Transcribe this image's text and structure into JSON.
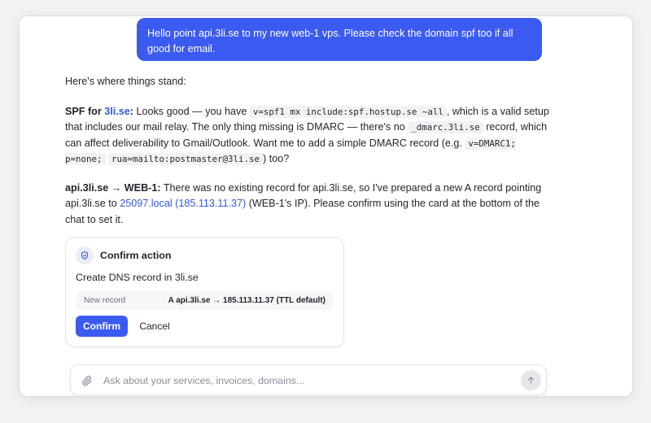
{
  "chat": {
    "user_message": "Hello point api.3li.se to my new web-1 vps. Please check the domain spf too if all good for email."
  },
  "assistant": {
    "intro": "Here's where things stand:",
    "spf": {
      "label_prefix": "SPF for ",
      "domain_link": "3li.se",
      "label_suffix": ":",
      "t1": " Looks good — you have ",
      "code1": "v=spf1 mx include:spf.hostup.se ~all",
      "t2": ", which is a valid setup that includes our mail relay. The only thing missing is DMARC — there's no ",
      "code2": "_dmarc.3li.se",
      "t3": " record, which can affect deliverability to Gmail/Outlook. Want me to add a simple DMARC record (e.g. ",
      "code3a": "v=DMARC1; p=none;",
      "code3b": "rua=mailto:postmaster@3li.se",
      "t4": ") too?"
    },
    "api": {
      "label": "api.3li.se → WEB-1:",
      "t1": " There was no existing record for api.3li.se, so I've prepared a new A record pointing api.3li.se to ",
      "link": "25097.local (185.113.11.37)",
      "t2": " (WEB-1's IP). Please confirm using the card at the bottom of the chat to set it."
    }
  },
  "confirm_card": {
    "title": "Confirm action",
    "description": "Create DNS record in 3li.se",
    "record_label": "New record",
    "record_value": "A api.3li.se → 185.113.11.37 (TTL default)",
    "confirm_label": "Confirm",
    "cancel_label": "Cancel",
    "icon": "shield-check-icon"
  },
  "composer": {
    "placeholder": "Ask about your services, invoices, domains...",
    "attach_icon": "paperclip-icon",
    "send_icon": "arrow-up-icon"
  },
  "colors": {
    "accent": "#3b5bf0",
    "link": "#2f5bd8"
  }
}
